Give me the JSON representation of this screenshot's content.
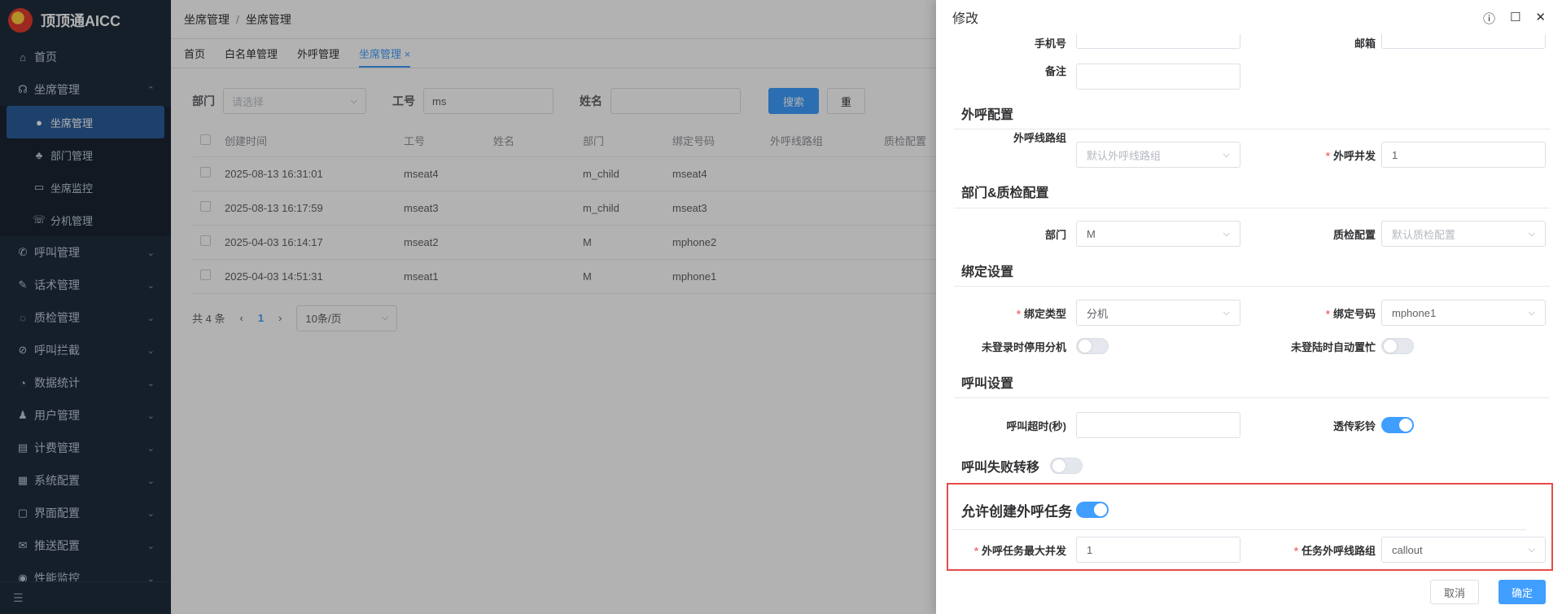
{
  "app": {
    "logo_text": "顶顶通AICC"
  },
  "sidebar": {
    "items": [
      {
        "label": "首页",
        "icon": "home-icon",
        "glyph": "⌂"
      },
      {
        "label": "坐席管理",
        "icon": "headset-icon",
        "glyph": "☊",
        "expanded": true
      },
      {
        "label": "呼叫管理",
        "icon": "phone-icon",
        "glyph": "✆"
      },
      {
        "label": "话术管理",
        "icon": "edit-icon",
        "glyph": "✎"
      },
      {
        "label": "质检管理",
        "icon": "chat-icon",
        "glyph": "◌"
      },
      {
        "label": "呼叫拦截",
        "icon": "block-phone-icon",
        "glyph": "⊘"
      },
      {
        "label": "数据统计",
        "icon": "pie-chart-icon",
        "glyph": "◔"
      },
      {
        "label": "用户管理",
        "icon": "users-icon",
        "glyph": "♟"
      },
      {
        "label": "计费管理",
        "icon": "billing-icon",
        "glyph": "▤"
      },
      {
        "label": "系统配置",
        "icon": "settings-icon",
        "glyph": "▦"
      },
      {
        "label": "界面配置",
        "icon": "layout-icon",
        "glyph": "▢"
      },
      {
        "label": "推送配置",
        "icon": "mail-icon",
        "glyph": "✉"
      },
      {
        "label": "性能监控",
        "icon": "monitor-icon",
        "glyph": "◉"
      }
    ],
    "submenu": [
      {
        "label": "坐席管理",
        "icon": "user-circle-icon",
        "glyph": "●",
        "active": true
      },
      {
        "label": "部门管理",
        "icon": "group-icon",
        "glyph": "♣"
      },
      {
        "label": "坐席监控",
        "icon": "screen-icon",
        "glyph": "▭"
      },
      {
        "label": "分机管理",
        "icon": "extension-phone-icon",
        "glyph": "☏"
      }
    ]
  },
  "header": {
    "breadcrumb": [
      "坐席管理",
      "坐席管理"
    ]
  },
  "tabs": [
    {
      "label": "首页"
    },
    {
      "label": "白名单管理"
    },
    {
      "label": "外呼管理"
    },
    {
      "label": "坐席管理 ×",
      "active": true
    }
  ],
  "filter": {
    "dept_label": "部门",
    "dept_placeholder": "请选择",
    "id_label": "工号",
    "id_value": "ms",
    "name_label": "姓名",
    "name_value": "",
    "search_btn": "搜索",
    "reset_btn": "重"
  },
  "table": {
    "headers": [
      "创建时间",
      "工号",
      "姓名",
      "部门",
      "绑定号码",
      "外呼线路组",
      "质检配置"
    ],
    "rows": [
      [
        "2025-08-13 16:31:01",
        "mseat4",
        "",
        "m_child",
        "mseat4",
        "",
        ""
      ],
      [
        "2025-08-13 16:17:59",
        "mseat3",
        "",
        "m_child",
        "mseat3",
        "",
        ""
      ],
      [
        "2025-04-03 16:14:17",
        "mseat2",
        "",
        "M",
        "mphone2",
        "",
        ""
      ],
      [
        "2025-04-03 14:51:31",
        "mseat1",
        "",
        "M",
        "mphone1",
        "",
        ""
      ]
    ]
  },
  "pager": {
    "total": "共 4 条",
    "current": "1",
    "page_size": "10条/页"
  },
  "drawer": {
    "title": "修改",
    "fields": {
      "phone_label": "手机号",
      "email_label": "邮箱",
      "remark_label": "备注",
      "section_callout": "外呼配置",
      "route_group_label": "外呼线路组",
      "route_group_placeholder": "默认外呼线路组",
      "concurrency_label": "外呼并发",
      "concurrency_value": "1",
      "section_dept": "部门&质检配置",
      "dept_label": "部门",
      "dept_value": "M",
      "qc_label": "质检配置",
      "qc_placeholder": "默认质检配置",
      "section_bind": "绑定设置",
      "bind_type_label": "绑定类型",
      "bind_type_value": "分机",
      "bind_number_label": "绑定号码",
      "bind_number_value": "mphone1",
      "disable_ext_label": "未登录时停用分机",
      "auto_busy_label": "未登陆时自动置忙",
      "section_call": "呼叫设置",
      "timeout_label": "呼叫超时(秒)",
      "ringback_label": "透传彩铃",
      "call_fail_transfer_label": "呼叫失败转移",
      "allow_task_label": "允许创建外呼任务",
      "task_max_conc_label": "外呼任务最大并发",
      "task_max_conc_value": "1",
      "task_route_label": "任务外呼线路组",
      "task_route_value": "callout"
    },
    "switches": {
      "disable_ext": false,
      "auto_busy": false,
      "ringback": true,
      "call_fail_transfer": false,
      "allow_task": true
    },
    "cancel_btn": "取消",
    "ok_btn": "确定"
  },
  "colors": {
    "accent": "#409eff",
    "sidebar_bg": "#1f2d3d",
    "highlight": "#e84a4a"
  }
}
